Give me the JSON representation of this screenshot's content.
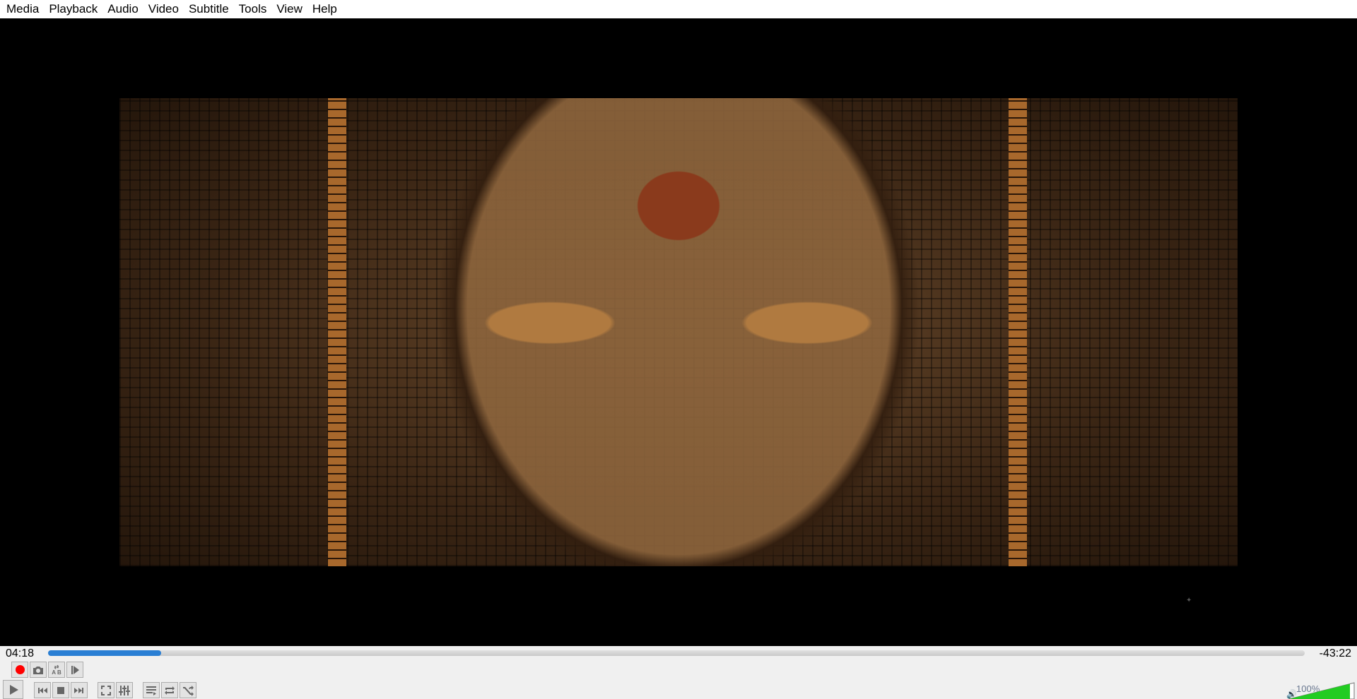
{
  "menu": [
    "Media",
    "Playback",
    "Audio",
    "Video",
    "Subtitle",
    "Tools",
    "View",
    "Help"
  ],
  "playback": {
    "elapsed": "04:18",
    "remaining": "-43:22",
    "progress_fraction": 0.09
  },
  "volume": {
    "label": "100%",
    "level_percent": 100
  },
  "colors": {
    "seek_fill": "#2a7fd4",
    "record": "#ff0000",
    "volume_fill": "#22cc22"
  },
  "buttons": [
    "record",
    "snapshot",
    "loop-ab",
    "frame-by-frame",
    "play",
    "previous",
    "stop",
    "next",
    "fullscreen",
    "extended-settings",
    "playlist",
    "loop",
    "random"
  ]
}
